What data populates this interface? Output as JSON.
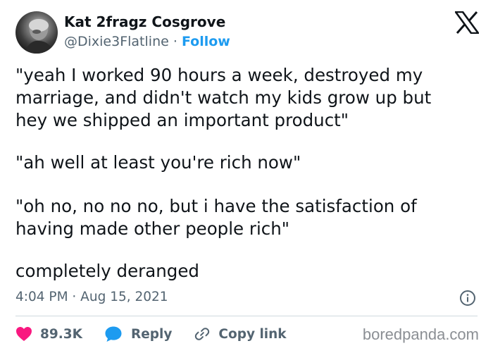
{
  "author": {
    "display_name": "Kat 2fragz Cosgrove",
    "handle": "@Dixie3Flatline",
    "separator": " · ",
    "follow_label": "Follow"
  },
  "tweet": {
    "paragraph_1_line_1": "\"yeah I worked 90 hours a week, destroyed my",
    "paragraph_1_line_2": "marriage, and didn't watch my kids grow up but",
    "paragraph_1_line_3": "hey we shipped an important product\"",
    "paragraph_2": "\"ah well at least you're rich now\"",
    "paragraph_3_line_1": "\"oh no, no no no, but i have the satisfaction of",
    "paragraph_3_line_2": "having made other people rich\"",
    "paragraph_4": "completely deranged",
    "timestamp": "4:04 PM · Aug 15, 2021"
  },
  "actions": {
    "like_count": "89.3K",
    "reply_label": "Reply",
    "copy_link_label": "Copy link"
  },
  "watermark": "boredpanda.com",
  "colors": {
    "accent": "#1d9bf0",
    "like": "#f91880",
    "muted": "#536471",
    "text": "#0f1419"
  },
  "icons": [
    "x-logo-icon",
    "info-icon",
    "heart-icon",
    "reply-bubble-icon",
    "link-icon"
  ]
}
